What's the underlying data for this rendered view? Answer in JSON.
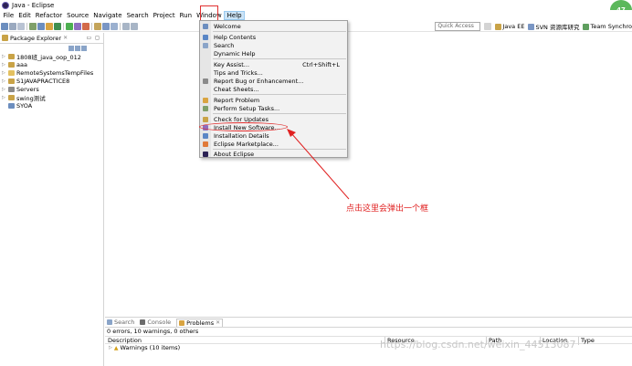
{
  "window": {
    "title": "Java - Eclipse",
    "badge": "47"
  },
  "menubar": {
    "items": [
      "File",
      "Edit",
      "Refactor",
      "Source",
      "Navigate",
      "Search",
      "Project",
      "Run",
      "Window",
      "Help"
    ]
  },
  "toolbar": {
    "quick_access": "Quick Access",
    "perspectives": [
      "Java EE",
      "SVN 资源库研究",
      "Team Synchro"
    ]
  },
  "package_explorer": {
    "title": "Package Explorer",
    "tree": [
      {
        "label": "1808班_java_oop_012",
        "kind": "proj"
      },
      {
        "label": "aaa",
        "kind": "proj"
      },
      {
        "label": "RemoteSystemsTempFiles",
        "kind": "folder"
      },
      {
        "label": "S1JAVAPRACTICE8",
        "kind": "proj"
      },
      {
        "label": "Servers",
        "kind": "server"
      },
      {
        "label": "swing测试",
        "kind": "proj"
      },
      {
        "label": "SYOA",
        "kind": "file"
      }
    ]
  },
  "help_menu": {
    "welcome": "Welcome",
    "help_contents": "Help Contents",
    "search": "Search",
    "dynamic_help": "Dynamic Help",
    "key_assist": "Key Assist...",
    "key_assist_shortcut": "Ctrl+Shift+L",
    "tips_and_tricks": "Tips and Tricks...",
    "report_bug": "Report Bug or Enhancement...",
    "cheat_sheets": "Cheat Sheets...",
    "report_problem": "Report Problem",
    "perform_setup_tasks": "Perform Setup Tasks...",
    "check_for_updates": "Check for Updates",
    "install_new_software": "Install New Software...",
    "installation_details": "Installation Details",
    "eclipse_marketplace": "Eclipse Marketplace...",
    "about_eclipse": "About Eclipse"
  },
  "annotation": {
    "text": "点击这里会弹出一个框"
  },
  "bottom_panel": {
    "tabs": [
      "Search",
      "Console",
      "Problems"
    ],
    "active_tab": "Problems",
    "summary": "0 errors, 10 warnings, 0 others",
    "columns": [
      "Description",
      "Resource",
      "Path",
      "Location",
      "Type"
    ],
    "warnings_row": "Warnings (10 items)"
  },
  "watermark": "https://blog.csdn.net/weixin_44513087",
  "colors": {
    "annotation_red": "#e02020",
    "menu_bg": "#f2f2f2",
    "active_menu": "#cce4f7"
  }
}
